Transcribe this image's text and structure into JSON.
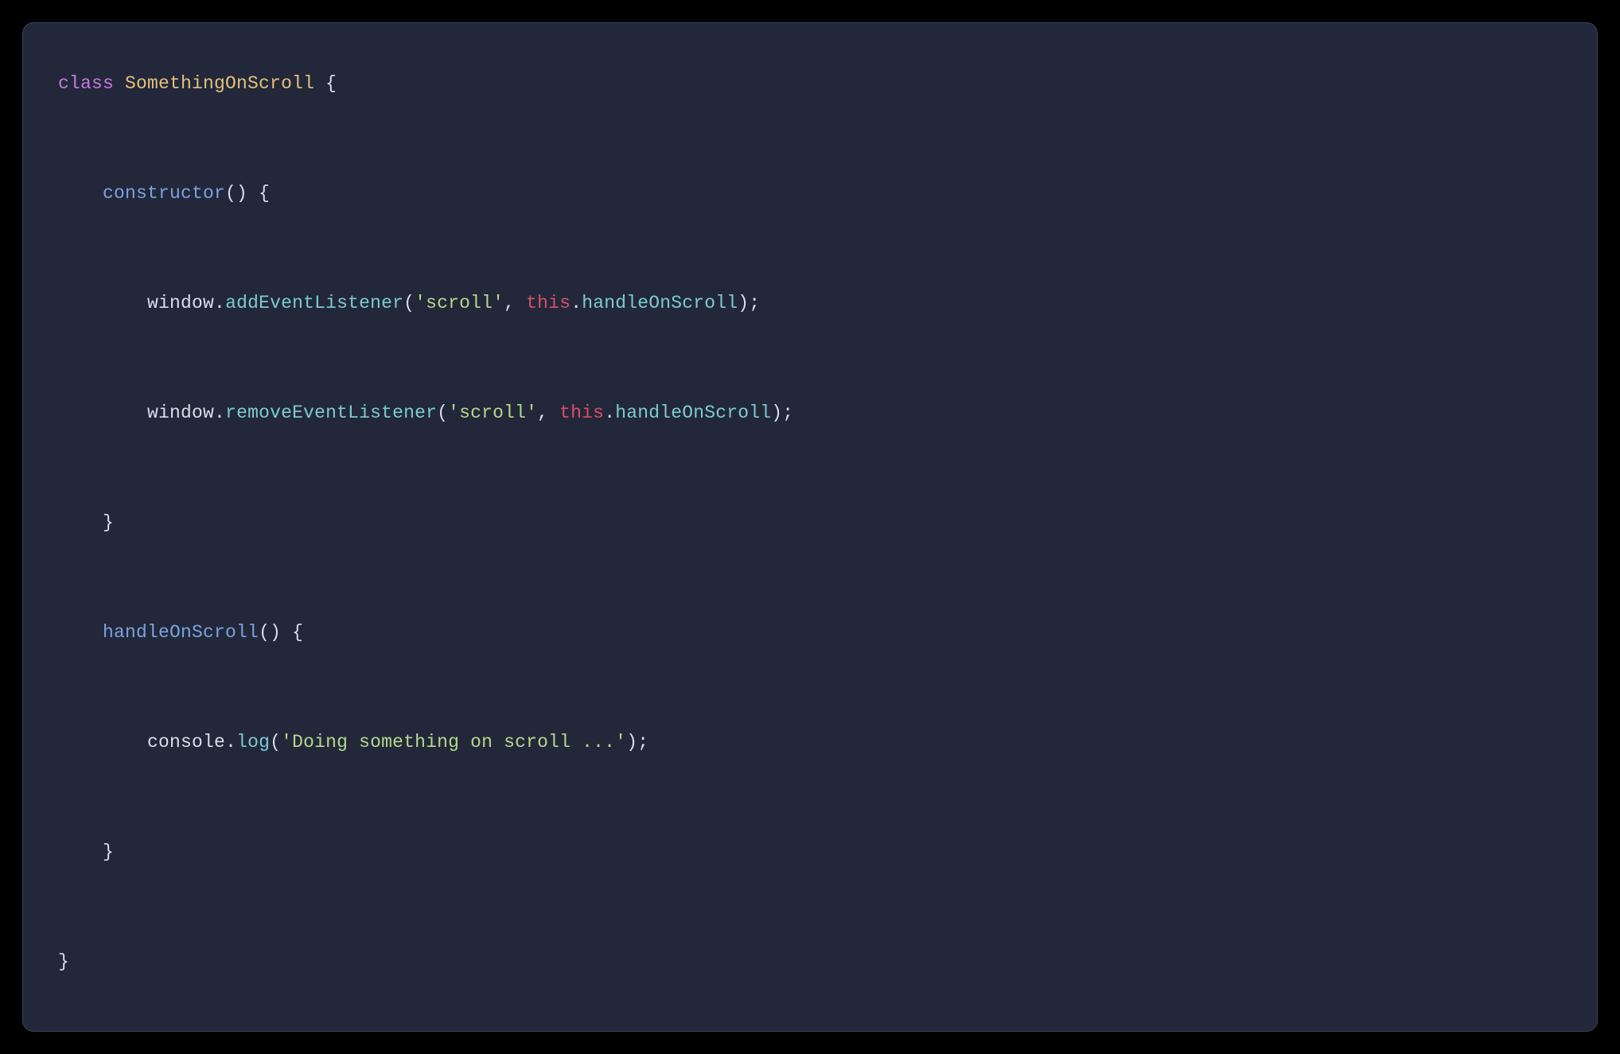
{
  "code": {
    "tokens": {
      "class_kw": "class",
      "class_name": "SomethingOnScroll",
      "open_brace": "{",
      "close_brace": "}",
      "constructor_kw": "constructor",
      "parens": "()",
      "window": "window",
      "dot": ".",
      "addEventListener": "addEventListener",
      "removeEventListener": "removeEventListener",
      "open_paren": "(",
      "close_paren": ")",
      "scroll_str": "'scroll'",
      "comma_sp": ", ",
      "this_kw": "this",
      "handleOnScroll": "handleOnScroll",
      "semicolon": ";",
      "console": "console",
      "log": "log",
      "log_str": "'Doing something on scroll ...'"
    }
  },
  "colors": {
    "bg_outer": "#000000",
    "bg_panel": "#22283a",
    "border_panel": "#3a4160",
    "keyword": "#c678dd",
    "classname": "#e5c07b",
    "function": "#7da0e0",
    "identifier": "#d8dee9",
    "call": "#7ecad1",
    "string": "#b7d88a",
    "this": "#d84f66",
    "punct": "#d8dee9"
  }
}
